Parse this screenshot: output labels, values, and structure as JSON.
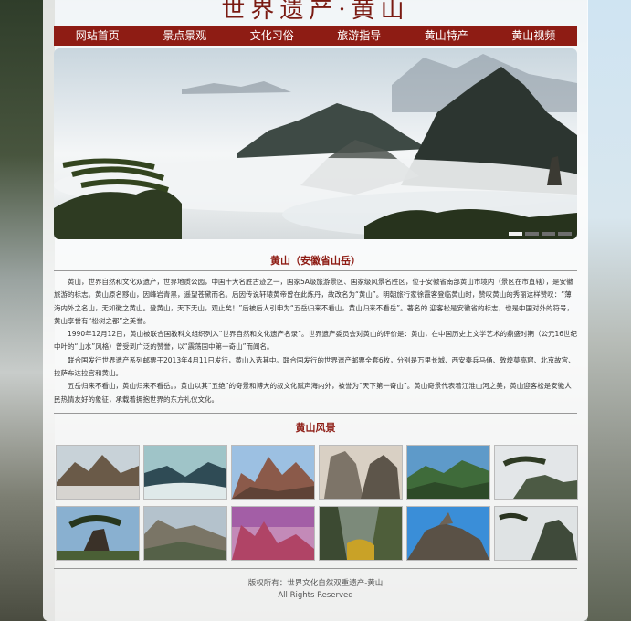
{
  "site": {
    "header_title": "世界遗产·黄山"
  },
  "nav": [
    {
      "label": "网站首页"
    },
    {
      "label": "景点景观"
    },
    {
      "label": "文化习俗"
    },
    {
      "label": "旅游指导"
    },
    {
      "label": "黄山特产"
    },
    {
      "label": "黄山视频"
    }
  ],
  "slider": {
    "dot_count": 4,
    "active_index": 0
  },
  "intro": {
    "title": "黄山（安徽省山岳）",
    "paragraphs": [
      "黄山，世界自然和文化双遗产，世界地质公园，中国十大名胜古迹之一，国家5A级旅游景区、国家级风景名胜区，位于安徽省南部黄山市境内（景区在市直辖），是安徽旅游的标志。黄山原名黟山，因峰岩青黑，遥望苍黛而名。后因传说轩辕黄帝曾在此炼丹，故改名为“黄山”。明朝旅行家徐霞客登临黄山时，赞叹黄山的秀丽这样赞叹：“薄海内外之名山，无如徽之黄山。登黄山，天下无山，观止矣！”后被后人引申为“五岳归来不看山，黄山归来不看岳”。著名的 迎客松是安徽省的标志，也是中国对外的符号，黄山享誉有“松树之都”之美誉。",
      "1990年12月12日，黄山被联合国教科文组织列入“世界自然和文化遗产名录”。世界遗产委员会对黄山的评价是：黄山，在中国历史上文学艺术的鼎盛时期（公元16世纪中叶的“山水”风格）曾受到广泛的赞誉，以“震荡国中第一奇山”而闻名。",
      "联合国发行世界遗产系列邮票于2013年4月11日发行，黄山入选其中。联合国发行的世界遗产邮票全套6枚，分别是万里长城、西安秦兵马俑、敦煌莫高窟、北京故宫、拉萨布达拉宫和黄山。",
      "五岳归来不看山，黄山归来不看岳。，黄山以其“五绝”的奇景和博大的叙文化赋声海内外，被誉为“天下第一奇山”。黄山奇景代表着江淮山河之美，黄山迎客松是安徽人民热情友好的象征，承载着拥抱世界的东方礼仪文化。"
    ]
  },
  "gallery": {
    "title": "黄山风景",
    "images": [
      {
        "name": "peak-cloud-sea"
      },
      {
        "name": "misty-ridge"
      },
      {
        "name": "red-rock-pinnacle"
      },
      {
        "name": "granite-towers"
      },
      {
        "name": "green-valley"
      },
      {
        "name": "pine-cliff"
      },
      {
        "name": "welcoming-pine"
      },
      {
        "name": "terraced-ridge"
      },
      {
        "name": "pink-sunset-peaks"
      },
      {
        "name": "autumn-gorge"
      },
      {
        "name": "summit-rock"
      },
      {
        "name": "pine-on-peak"
      }
    ]
  },
  "footer": {
    "copyright": "版权所有：世界文化自然双重遗产-黄山",
    "rights": "All Rights Reserved"
  },
  "colors": {
    "brand_red": "#8e1c14",
    "nav_text": "#ffffff",
    "heading": "#8e1c14"
  }
}
